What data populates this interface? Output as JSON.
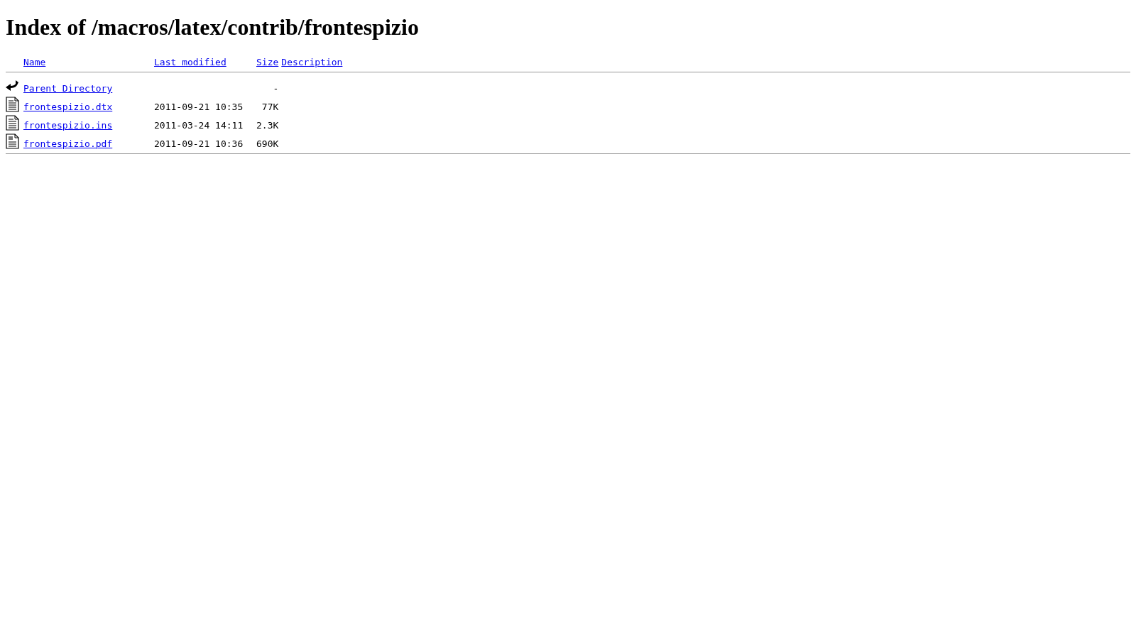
{
  "title": "Index of /macros/latex/contrib/frontespizio",
  "columns": [
    "Name",
    "Last modified",
    "Size",
    "Description"
  ],
  "rows": [
    {
      "kind": "parent",
      "name": "Parent Directory",
      "modified": "",
      "size": "-"
    },
    {
      "kind": "text",
      "name": "frontespizio.dtx",
      "modified": "2011-09-21 10:35",
      "size": "77K"
    },
    {
      "kind": "text",
      "name": "frontespizio.ins",
      "modified": "2011-03-24 14:11",
      "size": "2.3K"
    },
    {
      "kind": "layout",
      "name": "frontespizio.pdf",
      "modified": "2011-09-21 10:36",
      "size": "690K"
    }
  ]
}
